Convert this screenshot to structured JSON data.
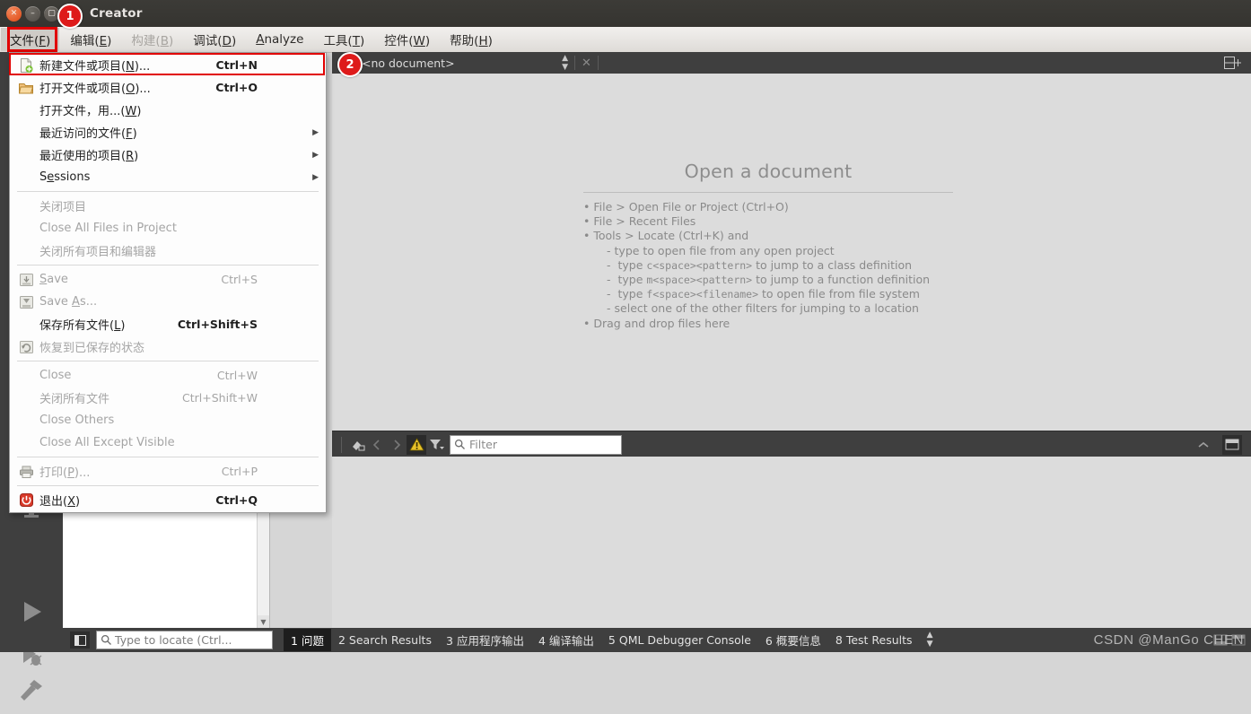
{
  "window": {
    "title": "Creator",
    "buttons": [
      "close",
      "minimize",
      "maximize"
    ]
  },
  "menubar": {
    "items": [
      {
        "label": "文件(F)",
        "mnemonic": "F",
        "state": "active"
      },
      {
        "label": "编辑(E)",
        "mnemonic": "E",
        "state": "normal"
      },
      {
        "label": "构建(B)",
        "mnemonic": "B",
        "state": "disabled"
      },
      {
        "label": "调试(D)",
        "mnemonic": "D",
        "state": "normal"
      },
      {
        "label": "Analyze",
        "mnemonic": "A",
        "state": "normal"
      },
      {
        "label": "工具(T)",
        "mnemonic": "T",
        "state": "normal"
      },
      {
        "label": "控件(W)",
        "mnemonic": "W",
        "state": "normal"
      },
      {
        "label": "帮助(H)",
        "mnemonic": "H",
        "state": "normal"
      }
    ]
  },
  "annotations": [
    {
      "id": "1",
      "label": "1"
    },
    {
      "id": "2",
      "label": "2"
    }
  ],
  "file_menu": {
    "rows": [
      {
        "type": "item",
        "label": "新建文件或项目(N)...",
        "shortcut": "Ctrl+N",
        "icon": "new-file-icon",
        "enabled": true,
        "highlighted": true,
        "submenu": false
      },
      {
        "type": "item",
        "label": "打开文件或项目(O)...",
        "shortcut": "Ctrl+O",
        "icon": "open-folder-icon",
        "enabled": true,
        "highlighted": false,
        "submenu": false
      },
      {
        "type": "item",
        "label": "打开文件，用...(W)",
        "shortcut": "",
        "icon": "",
        "enabled": true,
        "highlighted": false,
        "submenu": false
      },
      {
        "type": "item",
        "label": "最近访问的文件(F)",
        "shortcut": "",
        "icon": "",
        "enabled": true,
        "highlighted": false,
        "submenu": true
      },
      {
        "type": "item",
        "label": "最近使用的项目(R)",
        "shortcut": "",
        "icon": "",
        "enabled": true,
        "highlighted": false,
        "submenu": true
      },
      {
        "type": "item",
        "label": "Sessions",
        "shortcut": "",
        "icon": "",
        "enabled": true,
        "highlighted": false,
        "submenu": true
      },
      {
        "type": "separator"
      },
      {
        "type": "item",
        "label": "关闭项目",
        "shortcut": "",
        "icon": "",
        "enabled": false,
        "highlighted": false,
        "submenu": false
      },
      {
        "type": "item",
        "label": "Close All Files in Project",
        "shortcut": "",
        "icon": "",
        "enabled": false,
        "highlighted": false,
        "submenu": false
      },
      {
        "type": "item",
        "label": "关闭所有项目和编辑器",
        "shortcut": "",
        "icon": "",
        "enabled": false,
        "highlighted": false,
        "submenu": false
      },
      {
        "type": "separator"
      },
      {
        "type": "item",
        "label": "Save",
        "shortcut": "Ctrl+S",
        "icon": "save-icon",
        "enabled": false,
        "highlighted": false,
        "submenu": false
      },
      {
        "type": "item",
        "label": "Save As...",
        "shortcut": "",
        "icon": "save-as-icon",
        "enabled": false,
        "highlighted": false,
        "submenu": false
      },
      {
        "type": "item",
        "label": "保存所有文件(L)",
        "shortcut": "Ctrl+Shift+S",
        "icon": "",
        "enabled": true,
        "highlighted": false,
        "submenu": false
      },
      {
        "type": "item",
        "label": "恢复到已保存的状态",
        "shortcut": "",
        "icon": "revert-icon",
        "enabled": false,
        "highlighted": false,
        "submenu": false
      },
      {
        "type": "separator"
      },
      {
        "type": "item",
        "label": "Close",
        "shortcut": "Ctrl+W",
        "icon": "",
        "enabled": false,
        "highlighted": false,
        "submenu": false
      },
      {
        "type": "item",
        "label": "关闭所有文件",
        "shortcut": "Ctrl+Shift+W",
        "icon": "",
        "enabled": false,
        "highlighted": false,
        "submenu": false
      },
      {
        "type": "item",
        "label": "Close Others",
        "shortcut": "",
        "icon": "",
        "enabled": false,
        "highlighted": false,
        "submenu": false
      },
      {
        "type": "item",
        "label": "Close All Except Visible",
        "shortcut": "",
        "icon": "",
        "enabled": false,
        "highlighted": false,
        "submenu": false
      },
      {
        "type": "separator"
      },
      {
        "type": "item",
        "label": "打印(P)...",
        "shortcut": "Ctrl+P",
        "icon": "print-icon",
        "enabled": false,
        "highlighted": false,
        "submenu": false
      },
      {
        "type": "separator"
      },
      {
        "type": "item",
        "label": "退出(X)",
        "shortcut": "Ctrl+Q",
        "icon": "power-icon",
        "enabled": true,
        "highlighted": false,
        "submenu": false
      }
    ]
  },
  "modebar": {
    "items": [
      {
        "name": "design-mode",
        "icon": "monitor-icon"
      },
      {
        "name": "run-mode",
        "icon": "play-icon"
      },
      {
        "name": "debug-mode",
        "icon": "debug-bug-icon"
      },
      {
        "name": "build-mode",
        "icon": "hammer-icon"
      }
    ]
  },
  "editor": {
    "document_selector": "<no document>",
    "close_tab": "✕",
    "split_button": "split-editor-icon",
    "welcome": {
      "title": "Open a document",
      "lines": [
        {
          "indent": 0,
          "bullet": "•",
          "text": "File > Open File or Project (Ctrl+O)"
        },
        {
          "indent": 0,
          "bullet": "•",
          "text": "File > Recent Files"
        },
        {
          "indent": 0,
          "bullet": "•",
          "text": "Tools > Locate (Ctrl+K) and"
        },
        {
          "indent": 1,
          "bullet": "-",
          "text": "type to open file from any open project"
        },
        {
          "indent": 1,
          "bullet": "-",
          "text": "type c<space><pattern> to jump to a class definition"
        },
        {
          "indent": 1,
          "bullet": "-",
          "text": "type m<space><pattern> to jump to a function definition"
        },
        {
          "indent": 1,
          "bullet": "-",
          "text": "type f<space><filename> to open file from file system"
        },
        {
          "indent": 1,
          "bullet": "-",
          "text": "select one of the other filters for jumping to a location"
        },
        {
          "indent": 0,
          "bullet": "•",
          "text": "Drag and drop files here"
        }
      ]
    }
  },
  "output_toolbar": {
    "icons": [
      "clear-output-icon",
      "prev-item-icon",
      "next-item-icon",
      "warning-icon",
      "filter-funnel-icon"
    ],
    "filter": {
      "placeholder": "Filter",
      "value": "",
      "icon": "search-icon"
    },
    "right_icons": [
      "collapse-up-icon",
      "maximize-pane-icon"
    ]
  },
  "statusbar": {
    "sidebar_toggle": "sidebar-toggle-icon",
    "locator": {
      "placeholder": "Type to locate (Ctrl...",
      "value": "",
      "icon": "search-icon"
    },
    "tabs": [
      {
        "num": "1",
        "label": "问题",
        "selected": true
      },
      {
        "num": "2",
        "label": "Search Results",
        "selected": false
      },
      {
        "num": "3",
        "label": "应用程序输出",
        "selected": false
      },
      {
        "num": "4",
        "label": "编译输出",
        "selected": false
      },
      {
        "num": "5",
        "label": "QML Debugger Console",
        "selected": false
      },
      {
        "num": "6",
        "label": "概要信息",
        "selected": false
      },
      {
        "num": "8",
        "label": "Test Results",
        "selected": false
      }
    ],
    "spinner": "updown-arrows-icon",
    "watermark": "CSDN @ManGo CHEN"
  },
  "colors": {
    "accent_red": "#de1a1a",
    "dark_chrome": "#3f3f3f",
    "titlebar": "#3c3b37",
    "editor_bg": "#dcdcdc",
    "menu_bg": "#fdfdfd",
    "warning_yellow": "#e8c22a"
  }
}
